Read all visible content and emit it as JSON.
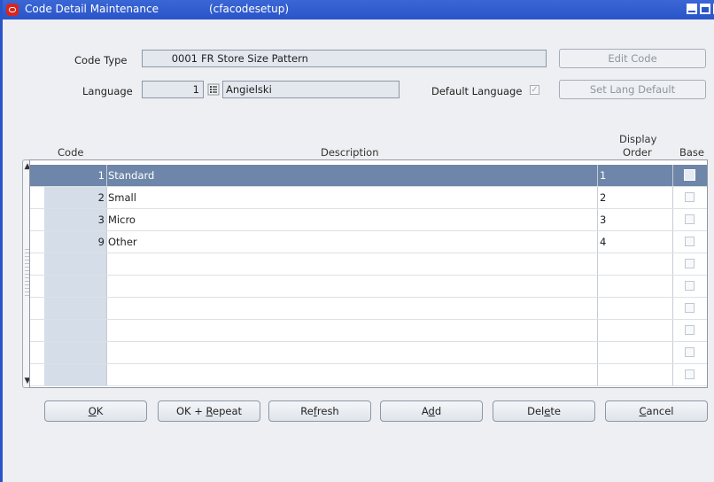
{
  "window": {
    "title": "Code Detail Maintenance",
    "subtitle": "(cfacodesetup)"
  },
  "form": {
    "code_type_label": "Code Type",
    "code_type_value": "0001",
    "code_type_desc": "FR Store Size Pattern",
    "language_label": "Language",
    "language_value": "1",
    "language_name": "Angielski",
    "default_language_label": "Default Language",
    "default_language_checked": true,
    "edit_code_label": "Edit Code",
    "set_lang_default_label": "Set Lang Default"
  },
  "grid": {
    "headers": {
      "code": "Code",
      "description": "Description",
      "display_order_line1": "Display",
      "display_order_line2": "Order",
      "base": "Base"
    },
    "rows": [
      {
        "code": "1",
        "description": "Standard",
        "order": "1",
        "base": false,
        "selected": true
      },
      {
        "code": "2",
        "description": "Small",
        "order": "2",
        "base": false
      },
      {
        "code": "3",
        "description": "Micro",
        "order": "3",
        "base": false
      },
      {
        "code": "9",
        "description": "Other",
        "order": "4",
        "base": false
      },
      {
        "code": "",
        "description": "",
        "order": "",
        "base": false
      },
      {
        "code": "",
        "description": "",
        "order": "",
        "base": false
      },
      {
        "code": "",
        "description": "",
        "order": "",
        "base": false
      },
      {
        "code": "",
        "description": "",
        "order": "",
        "base": false
      },
      {
        "code": "",
        "description": "",
        "order": "",
        "base": false
      },
      {
        "code": "",
        "description": "",
        "order": "",
        "base": false
      }
    ]
  },
  "buttons": {
    "ok": {
      "key": "O",
      "rest": "K"
    },
    "ok_repeat": {
      "pre": "OK + ",
      "key": "R",
      "rest": "epeat"
    },
    "refresh": {
      "pre": "Re",
      "key": "f",
      "rest": "resh"
    },
    "add": {
      "pre": "A",
      "key": "d",
      "rest": "d"
    },
    "delete": {
      "pre": "Del",
      "key": "e",
      "rest": "te"
    },
    "cancel": {
      "key": "C",
      "rest": "ancel"
    }
  }
}
